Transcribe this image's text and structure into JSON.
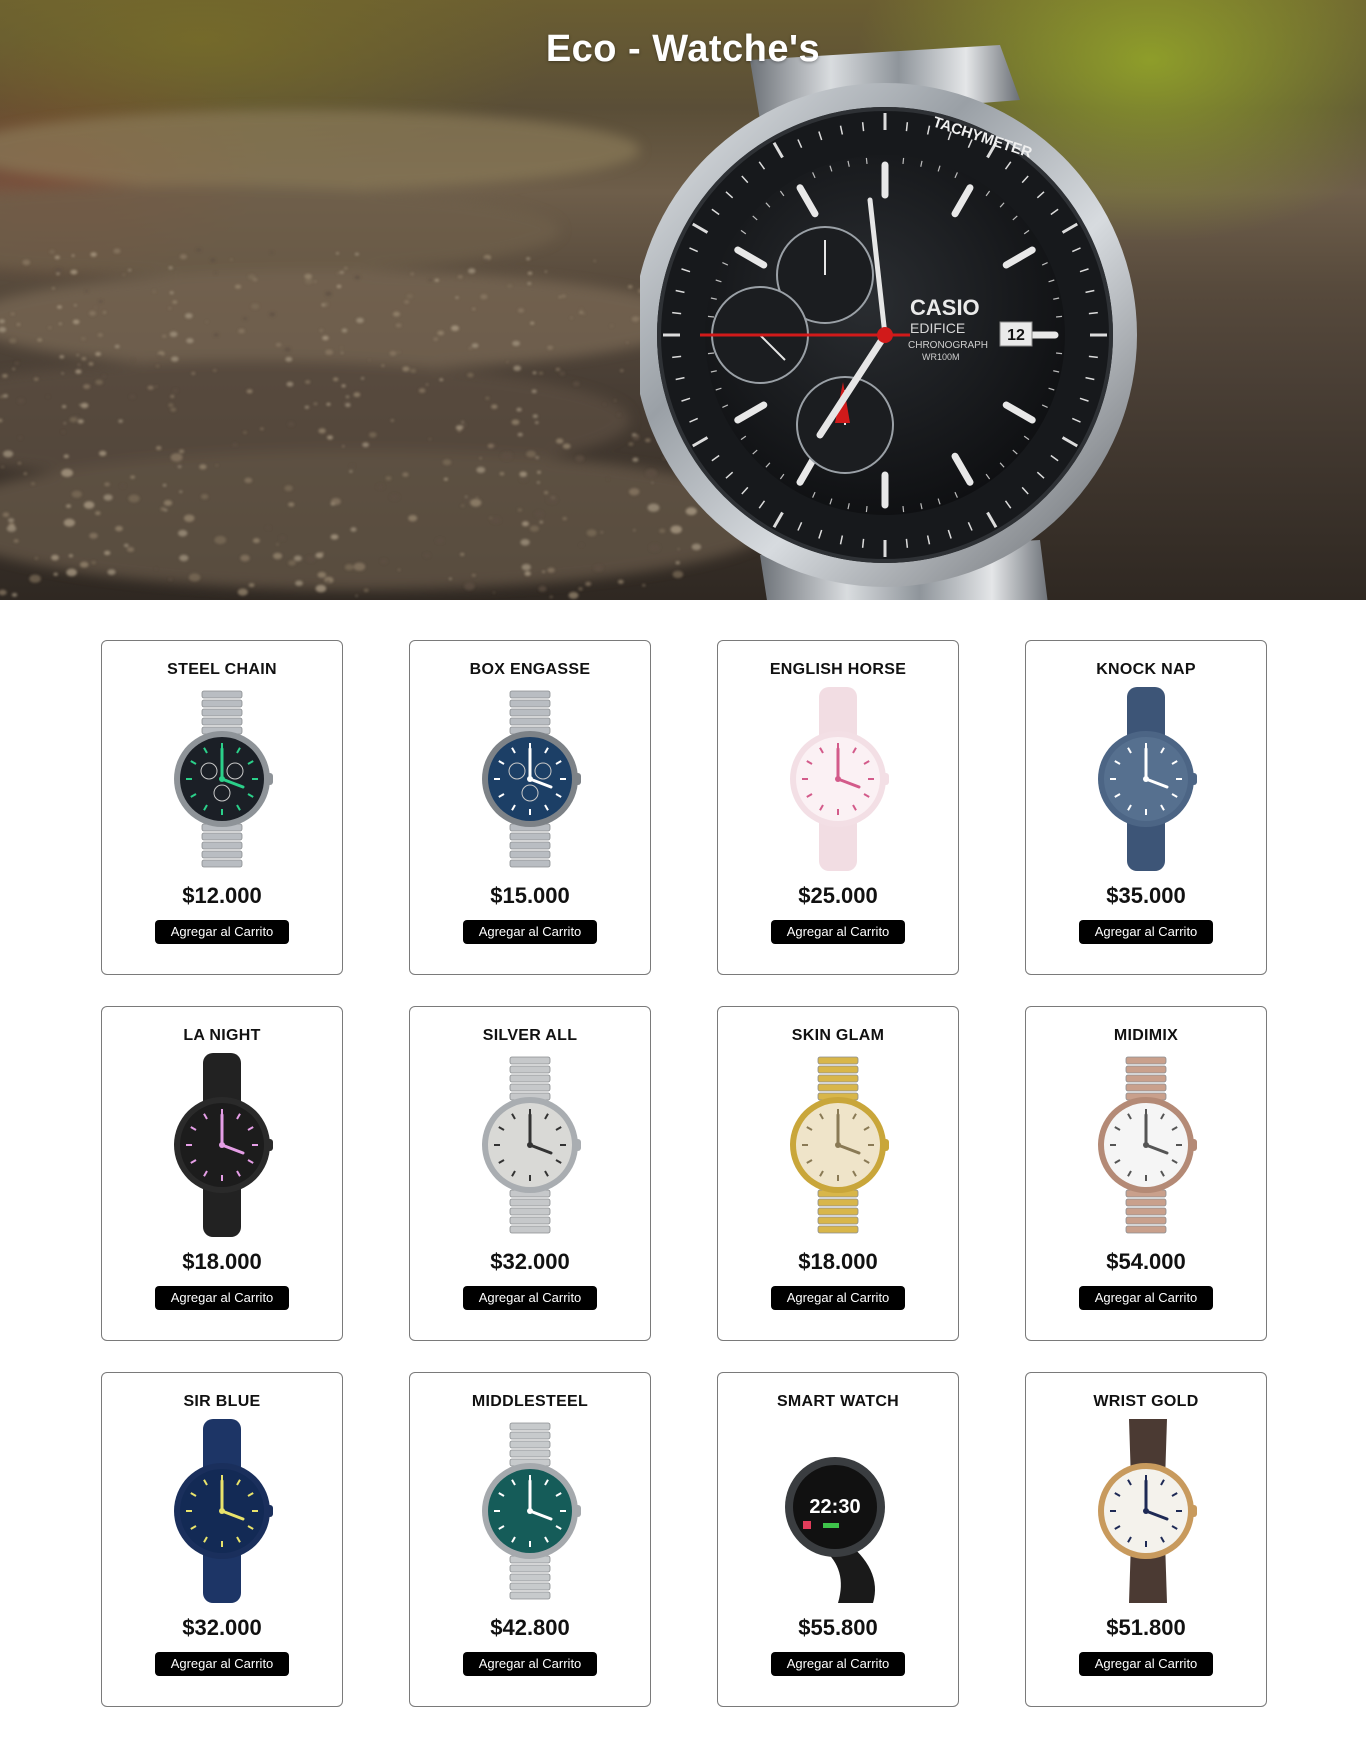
{
  "hero": {
    "title": "Eco - Watche's",
    "watch": {
      "brand": "CASIO",
      "model": "EDIFICE",
      "subtitle": "CHRONOGRAPH",
      "wr": "WR100M",
      "bezel_label": "TACHYMETER",
      "date": "12"
    }
  },
  "products": [
    {
      "name": "STEEL CHAIN",
      "price": "$12.000",
      "button": "Agregar al Carrito",
      "icon": "steel-chain-watch-icon",
      "style": "chrono-steel",
      "dial": "#1b1f26",
      "strap": "#b9bdc2",
      "case": "#8e9398",
      "hand": "#2bd08a"
    },
    {
      "name": "BOX ENGASSE",
      "price": "$15.000",
      "button": "Agregar al Carrito",
      "icon": "box-engasse-watch-icon",
      "style": "chrono-steel",
      "dial": "#1c3f66",
      "strap": "#b9bdc2",
      "case": "#7d8287",
      "hand": "#ffffff"
    },
    {
      "name": "ENGLISH HORSE",
      "price": "$25.000",
      "button": "Agregar al Carrito",
      "icon": "english-horse-watch-icon",
      "style": "plastic",
      "dial": "#fbf1f4",
      "strap": "#f2dde3",
      "case": "#f3dfe5",
      "hand": "#d35b8a"
    },
    {
      "name": "KNOCK NAP",
      "price": "$35.000",
      "button": "Agregar al Carrito",
      "icon": "knock-nap-watch-icon",
      "style": "plastic",
      "dial": "#56708f",
      "strap": "#3d5577",
      "case": "#4c6585",
      "hand": "#ffffff"
    },
    {
      "name": "LA NIGHT",
      "price": "$18.000",
      "button": "Agregar al Carrito",
      "icon": "la-night-watch-icon",
      "style": "plastic",
      "dial": "#1c1c1c",
      "strap": "#222222",
      "case": "#2a2a2a",
      "hand": "#e59ee6"
    },
    {
      "name": "SILVER ALL",
      "price": "$32.000",
      "button": "Agregar al Carrito",
      "icon": "silver-all-watch-icon",
      "style": "steel",
      "dial": "#d9d9d6",
      "strap": "#c6c8ca",
      "case": "#a9adb1",
      "hand": "#333333"
    },
    {
      "name": "SKIN GLAM",
      "price": "$18.000",
      "button": "Agregar al Carrito",
      "icon": "skin-glam-watch-icon",
      "style": "steel",
      "dial": "#efe4c9",
      "strap": "#d8b64a",
      "case": "#c9a63a",
      "hand": "#8a7a55"
    },
    {
      "name": "MIDIMIX",
      "price": "$54.000",
      "button": "Agregar al Carrito",
      "icon": "midimix-watch-icon",
      "style": "steel",
      "dial": "#f5f5f5",
      "strap": "#c9a08c",
      "case": "#b48a76",
      "hand": "#555555"
    },
    {
      "name": "SIR BLUE",
      "price": "$32.000",
      "button": "Agregar al Carrito",
      "icon": "sir-blue-watch-icon",
      "style": "plastic",
      "dial": "#132a55",
      "strap": "#1d3566",
      "case": "#1a2f5c",
      "hand": "#e9e36b"
    },
    {
      "name": "MIDDLESTEEL",
      "price": "$42.800",
      "button": "Agregar al Carrito",
      "icon": "middlesteel-watch-icon",
      "style": "steel",
      "dial": "#155c59",
      "strap": "#c7cacc",
      "case": "#a5a9ad",
      "hand": "#ffffff"
    },
    {
      "name": "SMART WATCH",
      "price": "$55.800",
      "button": "Agregar al Carrito",
      "icon": "smart-watch-icon",
      "style": "smart",
      "dial": "#111111",
      "strap": "#1a1a1a",
      "case": "#3a3d40",
      "hand": "#ffffff",
      "screen_time": "22:30"
    },
    {
      "name": "WRIST GOLD",
      "price": "$51.800",
      "button": "Agregar al Carrito",
      "icon": "wrist-gold-watch-icon",
      "style": "leather",
      "dial": "#f4f2ec",
      "strap": "#4b3a33",
      "case": "#c89a5d",
      "hand": "#1e2a55"
    }
  ]
}
